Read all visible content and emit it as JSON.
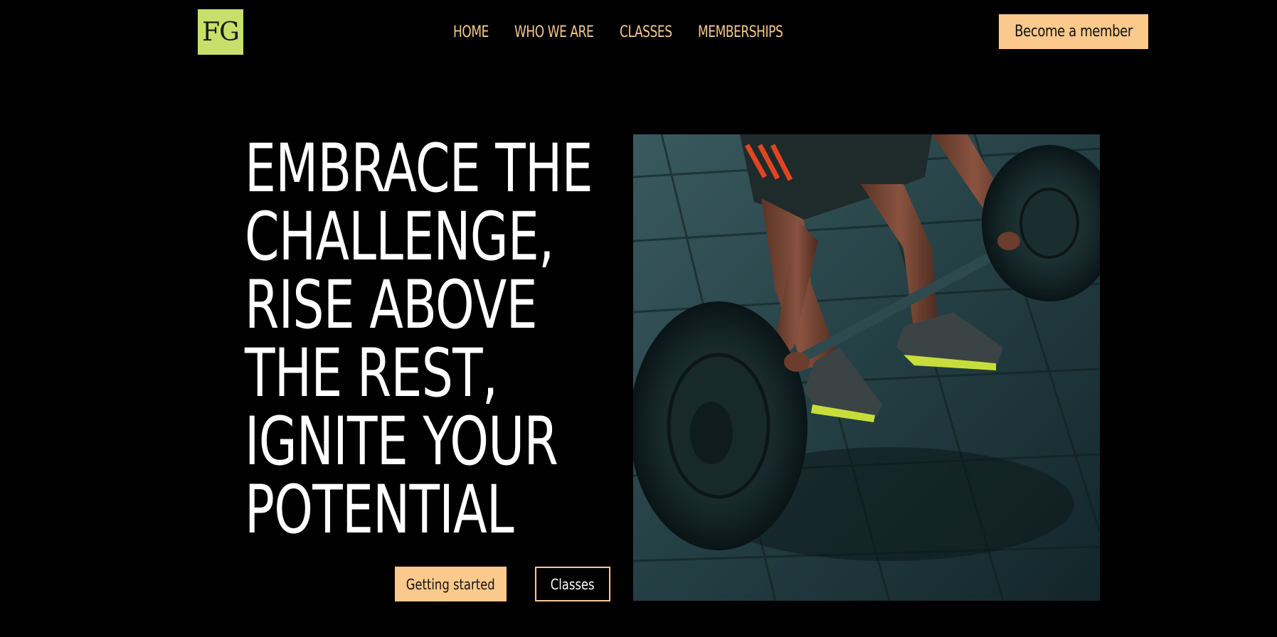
{
  "header": {
    "logo_text": "FG",
    "nav": [
      {
        "label": "HOME"
      },
      {
        "label": "WHO WE ARE"
      },
      {
        "label": "CLASSES"
      },
      {
        "label": "MEMBERSHIPS"
      }
    ],
    "cta_label": "Become a member"
  },
  "hero": {
    "headline_lines": [
      "EMBRACE THE",
      "CHALLENGE,",
      "RISE ABOVE",
      "THE REST,",
      "IGNITE YOUR",
      "POTENTIAL"
    ],
    "primary_button": "Getting started",
    "secondary_button": "Classes",
    "image_subject": "weightlifter-barbell-photo"
  },
  "colors": {
    "background": "#000000",
    "accent": "#fcc98c",
    "logo_bg": "#c8e06b",
    "headline": "#ffffff"
  }
}
